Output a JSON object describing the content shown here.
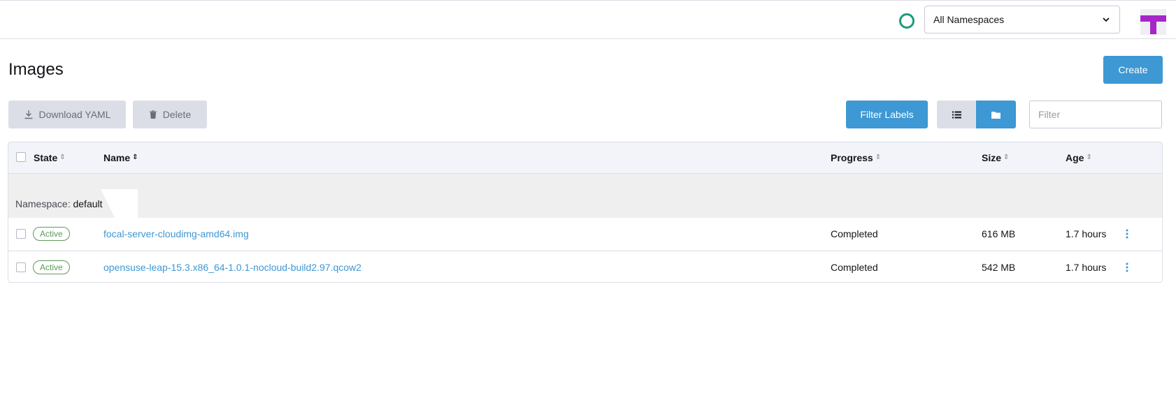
{
  "header": {
    "namespace_select": "All Namespaces"
  },
  "page": {
    "title": "Images",
    "create_label": "Create"
  },
  "toolbar": {
    "download_label": "Download YAML",
    "delete_label": "Delete",
    "filter_labels_label": "Filter Labels",
    "filter_placeholder": "Filter"
  },
  "table": {
    "columns": {
      "state": "State",
      "name": "Name",
      "progress": "Progress",
      "size": "Size",
      "age": "Age"
    },
    "group": {
      "prefix": "Namespace:",
      "name": "default"
    },
    "rows": [
      {
        "state": "Active",
        "name": "focal-server-cloudimg-amd64.img",
        "progress": "Completed",
        "size": "616 MB",
        "age": "1.7 hours"
      },
      {
        "state": "Active",
        "name": "opensuse-leap-15.3.x86_64-1.0.1-nocloud-build2.97.qcow2",
        "progress": "Completed",
        "size": "542 MB",
        "age": "1.7 hours"
      }
    ]
  },
  "colors": {
    "primary": "#3d98d3",
    "active_badge": "#5d995d",
    "status_ring": "#1d9a7c",
    "avatar": "#a526c9"
  },
  "icons": [
    "status-ring-icon",
    "chevron-down-icon",
    "download-icon",
    "trash-icon",
    "list-icon",
    "folder-icon",
    "sort-icon",
    "kebab-menu-icon"
  ]
}
